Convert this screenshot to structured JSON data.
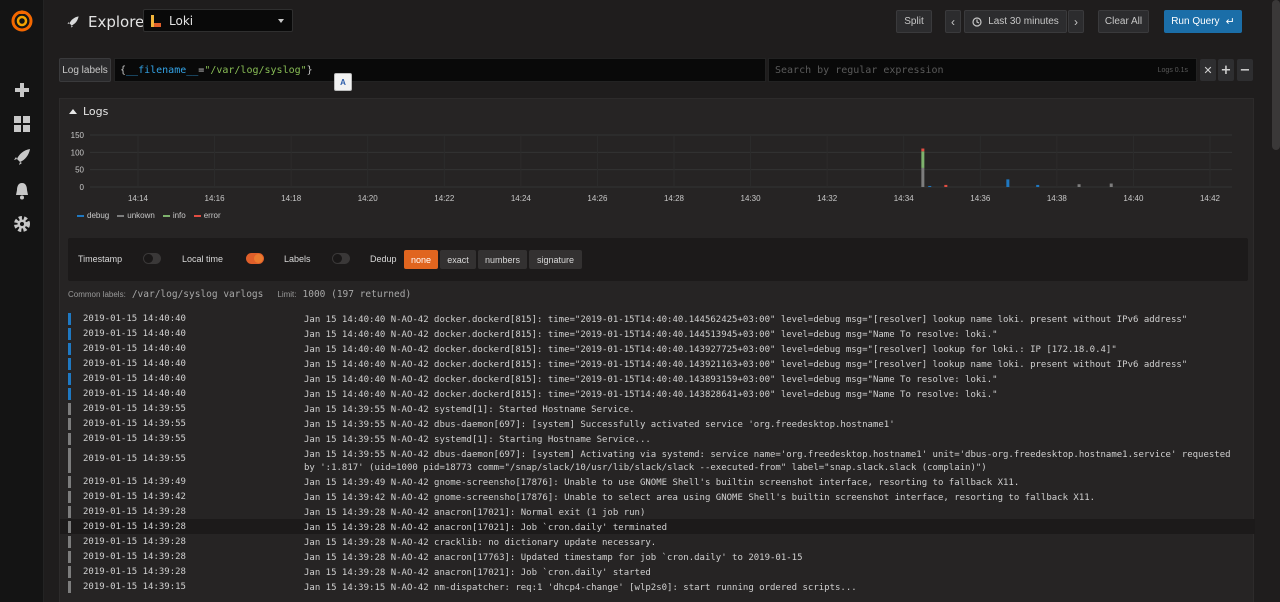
{
  "app": {
    "page_title": "Explore"
  },
  "datasource": {
    "name": "Loki"
  },
  "toolbar": {
    "split_label": "Split",
    "time_range": "Last 30 minutes",
    "clear_label": "Clear All",
    "run_label": "Run Query"
  },
  "query": {
    "label_button": "Log labels",
    "open_brace": "{",
    "key": "__filename__",
    "operator": "=",
    "value": "\"/var/log/syslog\"",
    "close_brace": "}",
    "regex_placeholder": "Search by regular expression",
    "regex_hint": "Logs 0.1s"
  },
  "logs": {
    "title": "Logs",
    "common_labels_label": "Common labels:",
    "common_labels_value": "/var/log/syslog varlogs",
    "limit_label": "Limit:",
    "limit_value": "1000 (197 returned)"
  },
  "controls": {
    "timestamp_label": "Timestamp",
    "localtime_label": "Local time",
    "labels_label": "Labels",
    "dedup_label": "Dedup",
    "dedup_options": [
      "none",
      "exact",
      "numbers",
      "signature"
    ],
    "toggles": {
      "timestamp": false,
      "local_time": true,
      "labels": false
    }
  },
  "colors": {
    "debug": "#1f78c1",
    "unknown": "#7d7d7d",
    "info": "#7eb26d",
    "error": "#e24d42"
  },
  "icons": {
    "sidebar": [
      "grafana-logo",
      "plus-icon",
      "dashboards-icon",
      "explore-icon",
      "bell-icon",
      "gear-icon"
    ]
  },
  "chart_data": {
    "type": "bar",
    "ylim": [
      0,
      150
    ],
    "yticks": [
      0,
      50,
      100,
      150
    ],
    "x_tick_labels": [
      "14:14",
      "14:16",
      "14:18",
      "14:20",
      "14:22",
      "14:24",
      "14:26",
      "14:28",
      "14:30",
      "14:32",
      "14:34",
      "14:36",
      "14:38",
      "14:40",
      "14:42"
    ],
    "legend": [
      {
        "name": "debug",
        "color": "#1f78c1"
      },
      {
        "name": "unkown",
        "color": "#7d7d7d"
      },
      {
        "name": "info",
        "color": "#7eb26d"
      },
      {
        "name": "error",
        "color": "#e24d42"
      }
    ],
    "series": [
      {
        "name": "debug",
        "points": [
          [
            14.578,
            3
          ],
          [
            14.612,
            22
          ],
          [
            14.625,
            6
          ],
          [
            14.725,
            14
          ],
          [
            14.77,
            3
          ],
          [
            14.817,
            28
          ],
          [
            14.84,
            20
          ],
          [
            14.885,
            10
          ]
        ]
      },
      {
        "name": "unkown",
        "points": [
          [
            14.575,
            55
          ],
          [
            14.643,
            8
          ],
          [
            14.657,
            10
          ],
          [
            14.765,
            10
          ],
          [
            14.818,
            14
          ],
          [
            14.85,
            8
          ],
          [
            14.862,
            10
          ],
          [
            14.872,
            12
          ]
        ]
      },
      {
        "name": "info",
        "points": [
          [
            14.575,
            48
          ],
          [
            14.818,
            12
          ],
          [
            14.862,
            6
          ]
        ]
      },
      {
        "name": "error",
        "points": [
          [
            14.575,
            8
          ],
          [
            14.585,
            6
          ]
        ]
      }
    ]
  },
  "log_rows": [
    {
      "level": "debug",
      "ts": "2019-01-15 14:40:40",
      "line": "Jan 15 14:40:40 N-AO-42 docker.dockerd[815]: time=\"2019-01-15T14:40:40.144562425+03:00\" level=debug msg=\"[resolver] lookup name loki. present without IPv6 address\""
    },
    {
      "level": "debug",
      "ts": "2019-01-15 14:40:40",
      "line": "Jan 15 14:40:40 N-AO-42 docker.dockerd[815]: time=\"2019-01-15T14:40:40.144513945+03:00\" level=debug msg=\"Name To resolve: loki.\""
    },
    {
      "level": "debug",
      "ts": "2019-01-15 14:40:40",
      "line": "Jan 15 14:40:40 N-AO-42 docker.dockerd[815]: time=\"2019-01-15T14:40:40.143927725+03:00\" level=debug msg=\"[resolver] lookup for loki.: IP [172.18.0.4]\""
    },
    {
      "level": "debug",
      "ts": "2019-01-15 14:40:40",
      "line": "Jan 15 14:40:40 N-AO-42 docker.dockerd[815]: time=\"2019-01-15T14:40:40.143921163+03:00\" level=debug msg=\"[resolver] lookup name loki. present without IPv6 address\""
    },
    {
      "level": "debug",
      "ts": "2019-01-15 14:40:40",
      "line": "Jan 15 14:40:40 N-AO-42 docker.dockerd[815]: time=\"2019-01-15T14:40:40.143893159+03:00\" level=debug msg=\"Name To resolve: loki.\""
    },
    {
      "level": "debug",
      "ts": "2019-01-15 14:40:40",
      "line": "Jan 15 14:40:40 N-AO-42 docker.dockerd[815]: time=\"2019-01-15T14:40:40.143828641+03:00\" level=debug msg=\"Name To resolve: loki.\""
    },
    {
      "level": "unknown",
      "ts": "2019-01-15 14:39:55",
      "line": "Jan 15 14:39:55 N-AO-42 systemd[1]: Started Hostname Service."
    },
    {
      "level": "unknown",
      "ts": "2019-01-15 14:39:55",
      "line": "Jan 15 14:39:55 N-AO-42 dbus-daemon[697]: [system] Successfully activated service 'org.freedesktop.hostname1'"
    },
    {
      "level": "unknown",
      "ts": "2019-01-15 14:39:55",
      "line": "Jan 15 14:39:55 N-AO-42 systemd[1]: Starting Hostname Service..."
    },
    {
      "level": "unknown",
      "ts": "2019-01-15 14:39:55",
      "line": "Jan 15 14:39:55 N-AO-42 dbus-daemon[697]: [system] Activating via systemd: service name='org.freedesktop.hostname1' unit='dbus-org.freedesktop.hostname1.service' requested by ':1.817' (uid=1000 pid=18773 comm=\"/snap/slack/10/usr/lib/slack/slack --executed-from\" label=\"snap.slack.slack (complain)\")",
      "tall": true
    },
    {
      "level": "unknown",
      "ts": "2019-01-15 14:39:49",
      "line": "Jan 15 14:39:49 N-AO-42 gnome-screensho[17876]: Unable to use GNOME Shell's builtin screenshot interface, resorting to fallback X11."
    },
    {
      "level": "unknown",
      "ts": "2019-01-15 14:39:42",
      "line": "Jan 15 14:39:42 N-AO-42 gnome-screensho[17876]: Unable to select area using GNOME Shell's builtin screenshot interface, resorting to fallback X11."
    },
    {
      "level": "unknown",
      "ts": "2019-01-15 14:39:28",
      "line": "Jan 15 14:39:28 N-AO-42 anacron[17021]: Normal exit (1 job run)"
    },
    {
      "level": "unknown",
      "ts": "2019-01-15 14:39:28",
      "line": "Jan 15 14:39:28 N-AO-42 anacron[17021]: Job `cron.daily' terminated",
      "highlight": true
    },
    {
      "level": "unknown",
      "ts": "2019-01-15 14:39:28",
      "line": "Jan 15 14:39:28 N-AO-42 cracklib: no dictionary update necessary."
    },
    {
      "level": "unknown",
      "ts": "2019-01-15 14:39:28",
      "line": "Jan 15 14:39:28 N-AO-42 anacron[17763]: Updated timestamp for job `cron.daily' to 2019-01-15"
    },
    {
      "level": "unknown",
      "ts": "2019-01-15 14:39:28",
      "line": "Jan 15 14:39:28 N-AO-42 anacron[17021]: Job `cron.daily' started"
    },
    {
      "level": "unknown",
      "ts": "2019-01-15 14:39:15",
      "line": "Jan 15 14:39:15 N-AO-42 nm-dispatcher: req:1 'dhcp4-change' [wlp2s0]: start running ordered scripts..."
    }
  ]
}
